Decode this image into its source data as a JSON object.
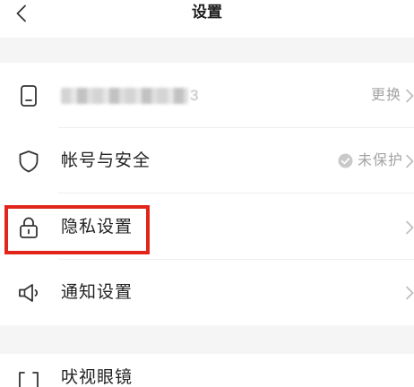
{
  "header": {
    "title": "设置",
    "back_icon": "chevron-left-icon"
  },
  "settings": {
    "phone": {
      "icon": "phone-icon",
      "number_visible_digit": "3",
      "action": "更换"
    },
    "account_security": {
      "icon": "shield-icon",
      "label": "帐号与安全",
      "status_icon": "check-circle-icon",
      "status": "未保护"
    },
    "privacy": {
      "icon": "lock-icon",
      "label": "隐私设置",
      "highlighted": true
    },
    "notifications": {
      "icon": "megaphone-icon",
      "label": "通知设置"
    },
    "glasses": {
      "icon": "glasses-icon",
      "label": "吠视眼镜"
    }
  },
  "colors": {
    "highlight_border": "#e1251b",
    "text": "#222222",
    "secondary_text": "#a3a3a3",
    "section_gap": "#f5f5f5"
  }
}
